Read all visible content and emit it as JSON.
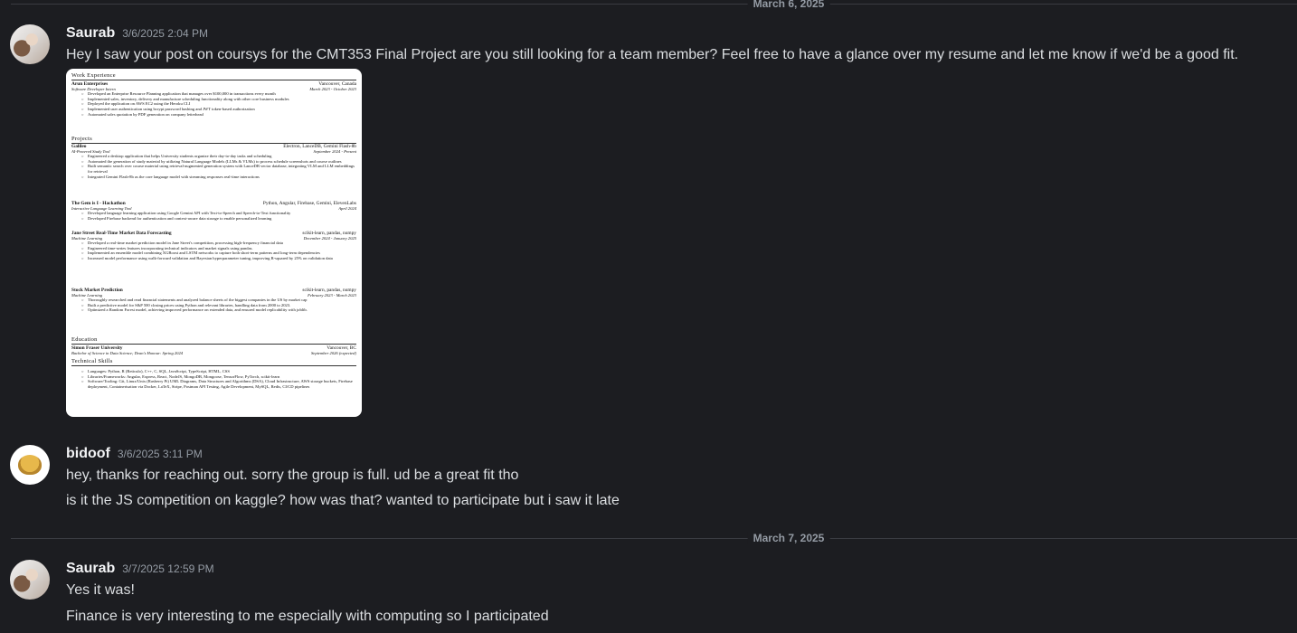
{
  "dividers": [
    "March 6, 2025",
    "March 7, 2025"
  ],
  "messages": [
    {
      "author": "Saurab",
      "timestamp": "3/6/2025 2:04 PM",
      "lines": [
        "Hey I saw your post on coursys for the CMT353 Final Project are you still looking for a team member? Feel free to have a glance over my resume and let me know if we'd be a good fit."
      ],
      "avatar": "saurab-avatar"
    },
    {
      "author": "bidoof",
      "timestamp": "3/6/2025 3:11 PM",
      "lines": [
        "hey, thanks for reaching out. sorry the group is full. ud be a great fit tho",
        "is it the JS competition on kaggle? how was that? wanted to participate but i saw it late"
      ],
      "avatar": "bidoof-avatar"
    },
    {
      "author": "Saurab",
      "timestamp": "3/7/2025 12:59 PM",
      "lines": [
        "Yes it was!",
        "Finance is very interesting to me especially with computing so I participated"
      ],
      "avatar": "saurab-avatar"
    }
  ],
  "resume": {
    "sections": {
      "work": "Work Experience",
      "projects": "Projects",
      "education": "Education",
      "skills": "Technical Skills"
    },
    "work": {
      "name": "Arun Enterprises",
      "location": "Vancouver, Canada",
      "role": "Software Developer Intern",
      "dates": "March 2023 - October 2023",
      "bullets": [
        "Developed an Enterprise Resource Planning application that manages over $100,000 in transactions every month",
        "Implemented sales, inventory, delivery and manufacture scheduling functionality along with other core business modules",
        "Deployed the application on AWS EC2 using the Heroku CLI",
        "Implemented user authentication using bcrypt password hashing and JWT token-based authorization",
        "Automated sales quotation by PDF generation on company letterhead"
      ]
    },
    "projects": [
      {
        "name": "Galileo",
        "tech": "Electron, LanceDB, Gemini Flash-8b",
        "sub": "AI-Powered Study Tool",
        "dates": "September 2024 - Present",
        "bullets": [
          "Engineered a desktop application that helps University students organize their day-to-day tasks and scheduling",
          "Automated the generation of study material by utilizing Natural Language Models (LLMs & VLMs) to process schedule screenshots and course outlines",
          "Built semantic search over course material using retrieval-augmented generation system with LanceDB vector database, integrating VLM and LLM embeddings for retrieval",
          "Integrated Gemini Flash-8b as the core language model with streaming responses real-time interactions"
        ]
      },
      {
        "name": "The Gem is I - Hackathon",
        "tech": "Python, Angular, Firebase, Gemini, ElevenLabs",
        "sub": "Interactive Language Learning Tool",
        "dates": "April 2024",
        "bullets": [
          "Developed language learning application using Google Gemini API with Text-to-Speech and Speech-to-Text functionality",
          "Developed Firebase backend for authentication and context-aware data storage to enable personalized learning"
        ]
      },
      {
        "name": "Jane Street Real-Time Market Data Forecasting",
        "tech": "scikit-learn, pandas, numpy",
        "sub": "Machine Learning",
        "dates": "December 2024 - January 2025",
        "bullets": [
          "Developed a real-time market prediction model in Jane Street's competition, processing high-frequency financial data",
          "Engineered time-series features incorporating technical indicators and market signals using pandas.",
          "Implemented an ensemble model combining XGBoost and LSTM networks to capture both short-term patterns and long-term dependencies",
          "Increased model performance using walk-forward validation and Bayesian hyperparameter tuning, improving R-squared by 25% on validation data"
        ]
      },
      {
        "name": "Stock Market Prediction",
        "tech": "scikit-learn, pandas, numpy",
        "sub": "Machine Learning",
        "dates": "February 2023 - March 2023",
        "bullets": [
          "Thoroughly researched and read financial statements and analyzed balance sheets of the biggest companies in the US by market cap",
          "Built a predictive model for S&P 500 closing prices using Python and relevant libraries, handling data from 2000 to 2023.",
          "Optimized a Random Forest model, achieving improved performance on extended data, and ensured model replicability with joblib."
        ]
      }
    ],
    "education": {
      "name": "Simon Fraser University",
      "location": "Vancouver, BC",
      "sub": "Bachelor of Science in Data Science; Dean's Honour: Spring 2024",
      "dates": "September 2026 (expected)"
    },
    "skills": [
      "Languages: Python, R (Reticulo), C++, C, SQL, JavaScript, TypeScript, HTML, CSS",
      "Libraries/Frameworks: Angular, Express, React, NodeJS, MongoDB, Mongoose, TensorFlow, PyTorch, scikit-learn",
      "Software/Tooling: Git, Linux/Unix (Rasberry Pi) UML Diagrams, Data Structures and Algorithms (DSA), Cloud Infrastructure, AWS storage buckets, Firebase deployment, Containerisation via Docker, LaTeX, Stripe, Postman API Testing, Agile Development, MySQL, Redis, CI/CD pipelines"
    ]
  }
}
